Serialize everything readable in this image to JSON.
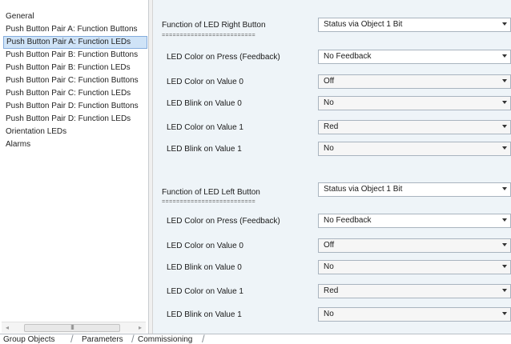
{
  "nav": {
    "items": [
      {
        "label": "General",
        "active": false
      },
      {
        "label": "Push Button Pair A: Function Buttons",
        "active": false
      },
      {
        "label": "Push Button Pair A: Function LEDs",
        "active": true
      },
      {
        "label": "Push Button Pair B: Function Buttons",
        "active": false
      },
      {
        "label": "Push Button Pair B: Function LEDs",
        "active": false
      },
      {
        "label": "Push Button Pair C: Function Buttons",
        "active": false
      },
      {
        "label": "Push Button Pair C: Function LEDs",
        "active": false
      },
      {
        "label": "Push Button Pair D: Function Buttons",
        "active": false
      },
      {
        "label": "Push Button Pair D: Function LEDs",
        "active": false
      },
      {
        "label": "Orientation LEDs",
        "active": false
      },
      {
        "label": "Alarms",
        "active": false
      }
    ],
    "scroll_thumb_label": "III",
    "scroll_left_icon": "◂",
    "scroll_right_icon": "▸"
  },
  "sections": [
    {
      "heading": "Function of LED Right Button",
      "heading_value": "Status via Object 1 Bit",
      "separator": "==========================",
      "params": [
        {
          "label": "LED Color on Press (Feedback)",
          "value": "No Feedback"
        },
        {
          "label": "LED Color on Value 0",
          "value": "Off"
        },
        {
          "label": "LED Blink on Value 0",
          "value": "No"
        },
        {
          "label": "LED Color on Value 1",
          "value": "Red"
        },
        {
          "label": "LED Blink on Value 1",
          "value": "No"
        }
      ]
    },
    {
      "heading": "Function of LED Left Button",
      "heading_value": "Status via Object 1 Bit",
      "separator": "==========================",
      "params": [
        {
          "label": "LED Color on Press (Feedback)",
          "value": "No Feedback"
        },
        {
          "label": "LED Color on Value 0",
          "value": "Off"
        },
        {
          "label": "LED Blink on Value 0",
          "value": "No"
        },
        {
          "label": "LED Color on Value 1",
          "value": "Red"
        },
        {
          "label": "LED Blink on Value 1",
          "value": "No"
        }
      ]
    }
  ],
  "tabs": [
    {
      "label": "Group Objects",
      "active": false
    },
    {
      "label": "Parameters",
      "active": true
    },
    {
      "label": "Commissioning",
      "active": false
    }
  ],
  "colors": {
    "nav_active_bg": "#cfe3f7",
    "nav_active_border": "#84acdd",
    "panel_bg": "#eef4f8"
  }
}
